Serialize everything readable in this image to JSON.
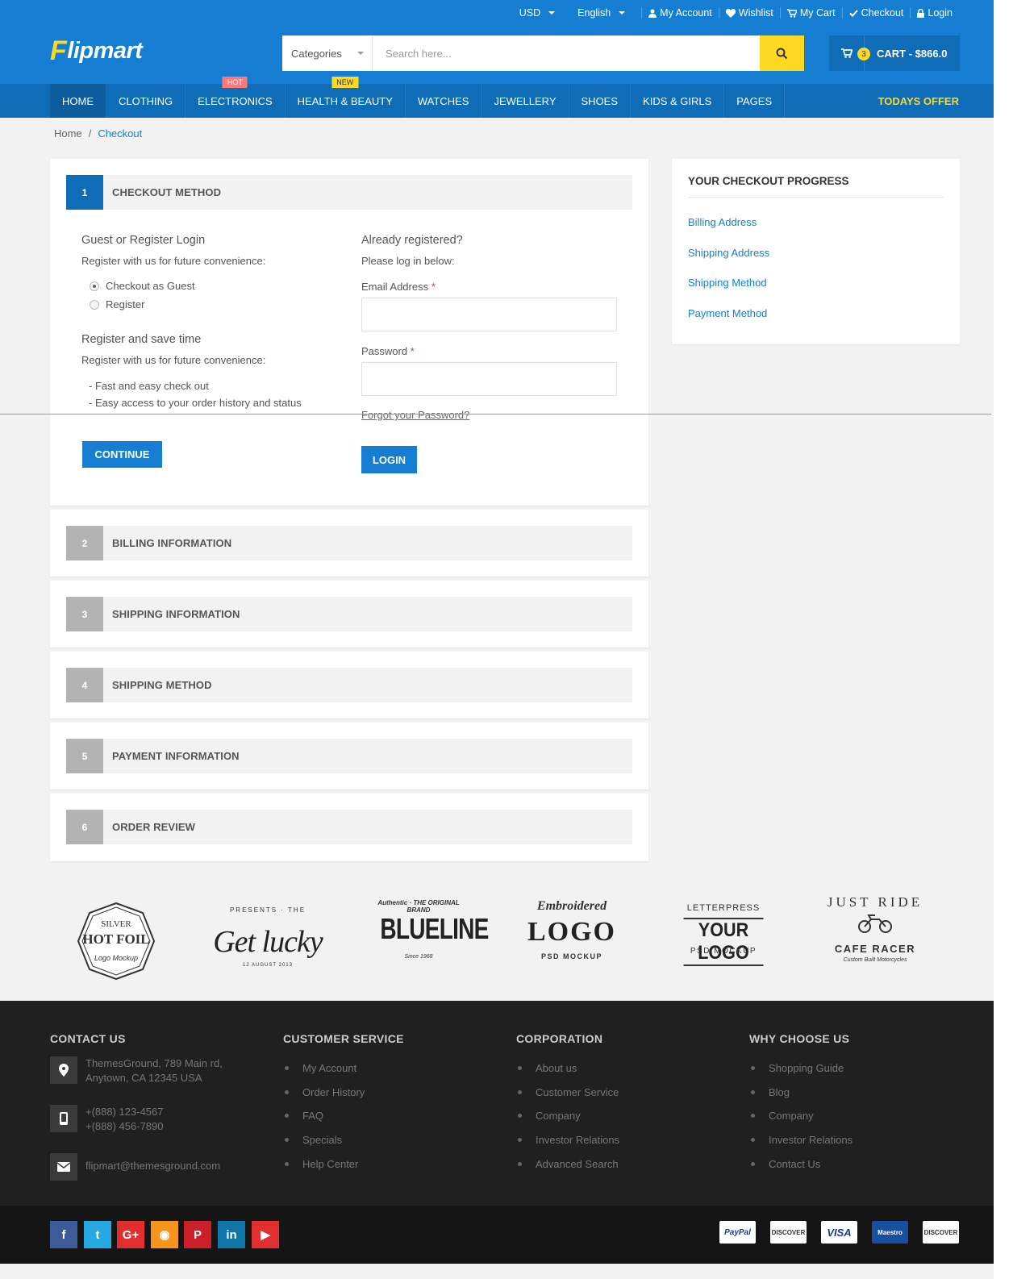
{
  "topbar": {
    "currency": "USD",
    "language": "English",
    "links": [
      "My Account",
      "Wishlist",
      "My Cart",
      "Checkout",
      "Login"
    ]
  },
  "logo": {
    "f": "F",
    "rest": "lipmart"
  },
  "search": {
    "category": "Categories",
    "placeholder": "Search here..."
  },
  "cart": {
    "count": "3",
    "label": "CART - $866.0"
  },
  "nav": {
    "items": [
      {
        "label": "HOME",
        "badge": ""
      },
      {
        "label": "CLOTHING",
        "badge": ""
      },
      {
        "label": "ELECTRONICS",
        "badge": "HOT"
      },
      {
        "label": "HEALTH & BEAUTY",
        "badge": "NEW"
      },
      {
        "label": "WATCHES",
        "badge": ""
      },
      {
        "label": "JEWELLERY",
        "badge": ""
      },
      {
        "label": "SHOES",
        "badge": ""
      },
      {
        "label": "KIDS & GIRLS",
        "badge": ""
      },
      {
        "label": "PAGES",
        "badge": ""
      }
    ],
    "offer": "TODAYS OFFER"
  },
  "breadcrumb": {
    "home": "Home",
    "sep": "/",
    "current": "Checkout"
  },
  "checkout": {
    "steps": [
      {
        "num": "1",
        "title": "CHECKOUT METHOD"
      },
      {
        "num": "2",
        "title": "BILLING INFORMATION"
      },
      {
        "num": "3",
        "title": "SHIPPING INFORMATION"
      },
      {
        "num": "4",
        "title": "SHIPPING METHOD"
      },
      {
        "num": "5",
        "title": "PAYMENT INFORMATION"
      },
      {
        "num": "6",
        "title": "ORDER REVIEW"
      }
    ],
    "guest": {
      "title": "Guest or Register Login",
      "subtitle": "Register with us for future convenience:",
      "options": [
        "Checkout as Guest",
        "Register"
      ],
      "title2": "Register and save time",
      "subtitle2": "Register with us for future convenience:",
      "benefits": [
        "- Fast and easy check out",
        "- Easy access to your order history and status"
      ],
      "continue": "CONTINUE"
    },
    "login": {
      "title": "Already registered?",
      "subtitle": "Please log in below:",
      "email_label": "Email Address",
      "password_label": "Password",
      "required_mark": "*",
      "forgot": "Forgot your Password?",
      "button": "LOGIN"
    }
  },
  "progress": {
    "title": "YOUR CHECKOUT PROGRESS",
    "items": [
      "Billing Address",
      "Shipping Address",
      "Shipping Method",
      "Payment Method"
    ]
  },
  "brands": [
    {
      "top": "SILVER",
      "main": "HOT FOIL",
      "sub": "Logo Mockup"
    },
    {
      "top": "PRESENTS · THE",
      "main": "Get lucky",
      "sub": "12 AUGUST 2013"
    },
    {
      "top": "Authentic · THE ORIGINAL BRAND",
      "main": "BLUELINE",
      "sub": "Since 1968"
    },
    {
      "top": "Embroidered",
      "main": "LOGO",
      "sub": "PSD MOCKUP"
    },
    {
      "top": "LETTERPRESS",
      "main": "YOUR LOGO",
      "sub": "PSD MOCKUP"
    },
    {
      "top": "JUST RIDE",
      "main": "CAFE RACER",
      "sub": "Custom Built Motorcycles"
    }
  ],
  "footer": {
    "contact": {
      "title": "CONTACT US",
      "address": [
        "ThemesGround, 789 Main rd,",
        "Anytown, CA 12345 USA"
      ],
      "phones": [
        "+(888) 123-4567",
        "+(888) 456-7890"
      ],
      "email": "flipmart@themesground.com"
    },
    "columns": [
      {
        "title": "CUSTOMER SERVICE",
        "links": [
          "My Account",
          "Order History",
          "FAQ",
          "Specials",
          "Help Center"
        ]
      },
      {
        "title": "CORPORATION",
        "links": [
          "About us",
          "Customer Service",
          "Company",
          "Investor Relations",
          "Advanced Search"
        ]
      },
      {
        "title": "WHY CHOOSE US",
        "links": [
          "Shopping Guide",
          "Blog",
          "Company",
          "Investor Relations",
          "Contact Us"
        ]
      }
    ]
  },
  "social": [
    {
      "icon": "facebook-icon",
      "glyph": "f",
      "color": "#3d5b99"
    },
    {
      "icon": "twitter-icon",
      "glyph": "t",
      "color": "#25a9e0"
    },
    {
      "icon": "google-plus-icon",
      "glyph": "G+",
      "color": "#e12e2e"
    },
    {
      "icon": "rss-icon",
      "glyph": "◉",
      "color": "#f7941d"
    },
    {
      "icon": "pinterest-icon",
      "glyph": "P",
      "color": "#cb2027"
    },
    {
      "icon": "linkedin-icon",
      "glyph": "in",
      "color": "#0e76a8"
    },
    {
      "icon": "youtube-icon",
      "glyph": "▶",
      "color": "#e12e2e"
    }
  ],
  "payments": [
    "PayPal",
    "DISCOVER",
    "VISA",
    "Maestro",
    "DISCOVER"
  ],
  "colors": {
    "primary": "#157ed2",
    "nav": "#0f6cb6",
    "accent": "#fdd922",
    "footer": "#202020"
  }
}
